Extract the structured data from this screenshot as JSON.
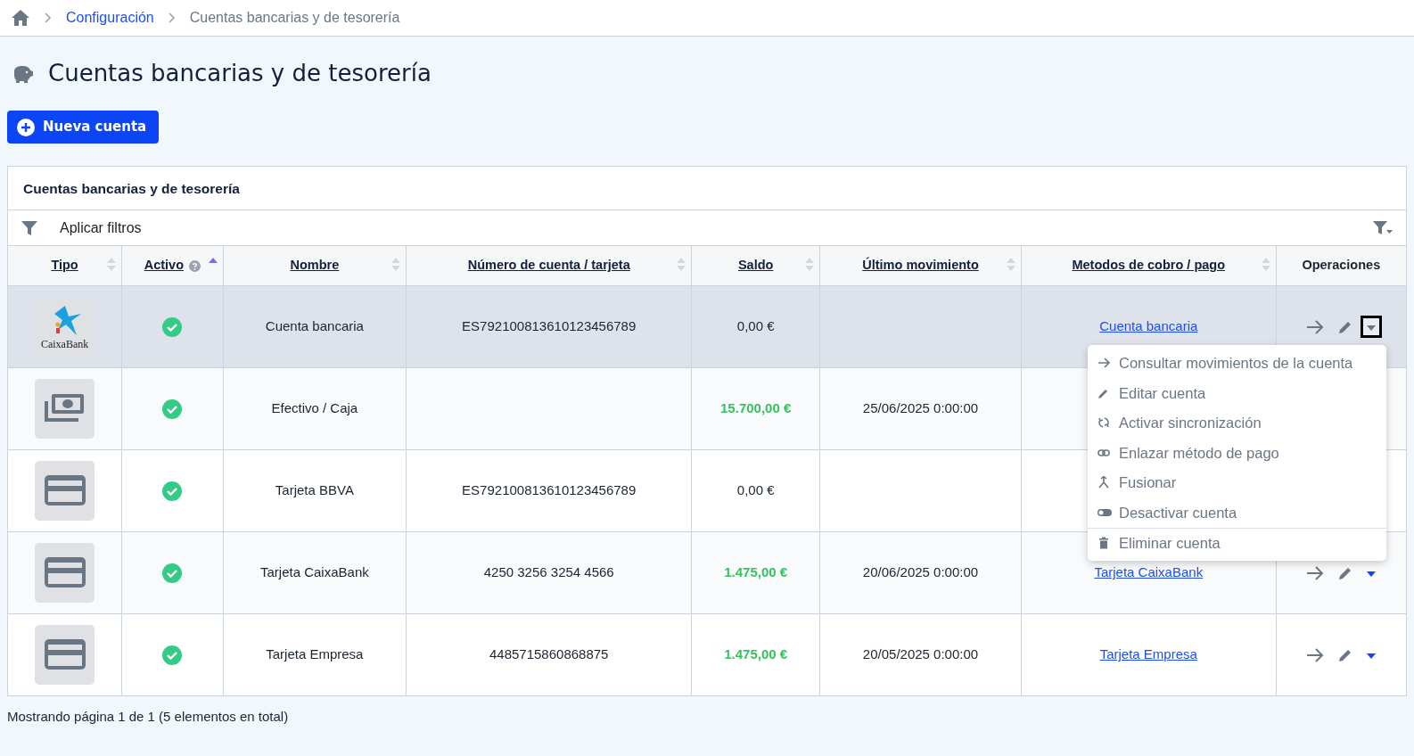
{
  "breadcrumb": [
    {
      "label": "Configuración",
      "link": true
    },
    {
      "label": "Cuentas bancarias y de tesorería",
      "link": false
    }
  ],
  "title": "Cuentas bancarias y de tesorería",
  "new_button": "Nueva cuenta",
  "card": {
    "title": "Cuentas bancarias y de tesorería",
    "filter_label": "Aplicar filtros",
    "columns": [
      {
        "label": "Tipo",
        "sortable": true,
        "sorted_asc": false,
        "help": false
      },
      {
        "label": "Activo",
        "sortable": true,
        "sorted_asc": true,
        "help": true
      },
      {
        "label": "Nombre",
        "sortable": true,
        "sorted_asc": false,
        "help": false
      },
      {
        "label": "Número de cuenta / tarjeta",
        "sortable": true,
        "sorted_asc": false,
        "help": false
      },
      {
        "label": "Saldo",
        "sortable": true,
        "sorted_asc": false,
        "help": false
      },
      {
        "label": "Último movimiento",
        "sortable": true,
        "sorted_asc": false,
        "help": false
      },
      {
        "label": "Metodos de cobro / pago",
        "sortable": true,
        "sorted_asc": false,
        "help": false
      },
      {
        "label": "Operaciones",
        "sortable": false,
        "help": false
      }
    ],
    "rows": [
      {
        "selected": true,
        "kind": "bank",
        "logo_text": "CaixaBank",
        "active": true,
        "name": "Cuenta bancaria",
        "number": "ES792100813610123456789",
        "balance": "0,00 €",
        "positive": false,
        "last": "",
        "method": "Cuenta bancaria",
        "operations": true,
        "expanded": true
      },
      {
        "selected": false,
        "kind": "cash",
        "active": true,
        "name": "Efectivo / Caja",
        "number": "",
        "balance": "15.700,00 €",
        "positive": true,
        "last": "25/06/2025 0:00:00",
        "method": "",
        "operations": false,
        "expanded": false
      },
      {
        "selected": false,
        "kind": "card",
        "active": true,
        "name": "Tarjeta BBVA",
        "number": "ES792100813610123456789",
        "balance": "0,00 €",
        "positive": false,
        "last": "",
        "method": "",
        "operations": false,
        "expanded": false
      },
      {
        "selected": false,
        "kind": "card",
        "active": true,
        "name": "Tarjeta CaixaBank",
        "number": "4250 3256 3254 4566",
        "balance": "1.475,00 €",
        "positive": true,
        "last": "20/06/2025 0:00:00",
        "method": "Tarjeta CaixaBank",
        "operations": true,
        "expanded": false
      },
      {
        "selected": false,
        "kind": "card",
        "active": true,
        "name": "Tarjeta Empresa",
        "number": "4485715860868875",
        "balance": "1.475,00 €",
        "positive": true,
        "last": "20/05/2025 0:00:00",
        "method": "Tarjeta Empresa",
        "operations": true,
        "expanded": false
      }
    ]
  },
  "menu": [
    {
      "kind": "arrow",
      "label": "Consultar movimientos de la cuenta",
      "divider": false
    },
    {
      "kind": "edit",
      "label": "Editar cuenta",
      "divider": false
    },
    {
      "kind": "sync",
      "label": "Activar sincronización",
      "divider": false
    },
    {
      "kind": "link",
      "label": "Enlazar método de pago",
      "divider": false
    },
    {
      "kind": "merge",
      "label": "Fusionar",
      "divider": false
    },
    {
      "kind": "toggle",
      "label": "Desactivar cuenta",
      "divider": false
    },
    {
      "kind": "trash",
      "label": "Eliminar cuenta",
      "divider": true
    }
  ],
  "footer": "Mostrando página 1 de 1 (5 elementos en total)"
}
